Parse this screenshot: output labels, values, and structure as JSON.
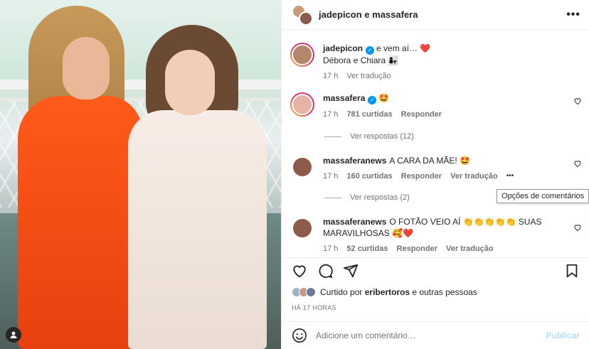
{
  "header": {
    "title": "jadepicon e massafera",
    "more_icon": "more-horizontal-icon"
  },
  "caption": {
    "username": "jadepicon",
    "text": "e vem aí… ❤️",
    "line2": "Débora e Chiara 👩‍👧",
    "time": "17 h",
    "translate": "Ver tradução"
  },
  "comments": [
    {
      "username": "massafera",
      "verified": true,
      "text": "🤩",
      "time": "17 h",
      "likes": "781 curtidas",
      "reply": "Responder",
      "view_replies": "Ver respostas (12)"
    },
    {
      "username": "massaferanews",
      "verified": false,
      "text": "A CARA DA MÃE! 🤩",
      "time": "17 h",
      "likes": "160 curtidas",
      "reply": "Responder",
      "translate": "Ver tradução",
      "options": "•••",
      "view_replies": "Ver respostas (2)"
    },
    {
      "username": "massaferanews",
      "verified": false,
      "text": "O FOTÃO VEIO AÍ 👏👏👏👏👏 SUAS MARAVILHOSAS 🥰❤️",
      "time": "17 h",
      "likes": "52 curtidas",
      "reply": "Responder",
      "translate": "Ver tradução"
    }
  ],
  "tooltip": "Opções de comentários",
  "likes_line": {
    "prefix": "Curtido por",
    "user": "eribertoros",
    "suffix": "e outras pessoas"
  },
  "timestamp": "HÁ 17 HORAS",
  "add_comment": {
    "placeholder": "Adicione um comentário…",
    "publish": "Publicar"
  },
  "colors": {
    "accent": "#0095f6",
    "publish_disabled": "#b2dffc",
    "heart": "#ed4956"
  }
}
